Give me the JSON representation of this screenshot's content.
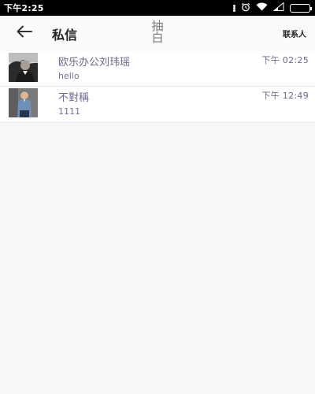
{
  "status_bar": {
    "time": "下午2:25",
    "icons": [
      "dots-icon",
      "alarm-icon",
      "wifi-icon",
      "signal-icon",
      "battery-icon"
    ]
  },
  "header": {
    "title": "私信",
    "watermark": "抽白",
    "contacts_label": "联系人"
  },
  "messages": [
    {
      "name": "欧乐办公刘玮瑶",
      "time": "下午 02:25",
      "preview": "hello"
    },
    {
      "name": "不對稱",
      "time": "下午 12:49",
      "preview": "1111"
    }
  ],
  "colors": {
    "name_text": "#6e6690",
    "status_bar": "#000000",
    "background": "#f8f8f8"
  }
}
